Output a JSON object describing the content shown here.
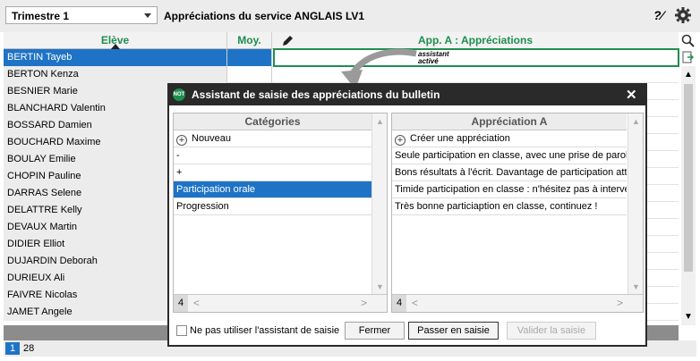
{
  "topbar": {
    "period": "Trimestre 1",
    "title": "Appréciations du service ANGLAIS LV1"
  },
  "grid": {
    "columns": {
      "eleve": "Elève",
      "moy": "Moy.",
      "app": "App. A : Appréciations"
    },
    "students": [
      "BERTIN Tayeb",
      "BERTON Kenza",
      "BESNIER Marie",
      "BLANCHARD Valentin",
      "BOSSARD Damien",
      "BOUCHARD Maxime",
      "BOULAY Emilie",
      "CHOPIN Pauline",
      "DARRAS Selene",
      "DELATTRE Kelly",
      "DEVAUX Martin",
      "DIDIER Elliot",
      "DUJARDIN Deborah",
      "DURIEUX Ali",
      "FAIVRE Nicolas",
      "JAMET Angele"
    ],
    "selected_index": 0,
    "assistant_badge": [
      "assistant",
      "activé"
    ]
  },
  "footer": {
    "page": "1",
    "total": "28"
  },
  "dialog": {
    "title": "Assistant de saisie des appréciations du bulletin",
    "categories": {
      "header": "Catégories",
      "new_label": "Nouveau",
      "items": [
        "-",
        "+",
        "Participation orale",
        "Progression"
      ],
      "selected_index": 2,
      "count": "4"
    },
    "appreciations": {
      "header": "Appréciation A",
      "new_label": "Créer une appréciation",
      "items": [
        "Seule participation en classe, avec une prise de parole",
        "Bons résultats à l'écrit. Davantage de participation attendue",
        "Timide participation en classe : n'hésitez pas à intervenir",
        "Très bonne particiaption en classe, continuez !"
      ],
      "count": "4"
    },
    "checkbox_label": "Ne pas utiliser l'assistant de saisie",
    "buttons": {
      "close": "Fermer",
      "enter": "Passer en saisie",
      "validate": "Valider la saisie"
    }
  },
  "colors": {
    "accent_green": "#1e8e4e",
    "selection_blue": "#1f73c6"
  }
}
